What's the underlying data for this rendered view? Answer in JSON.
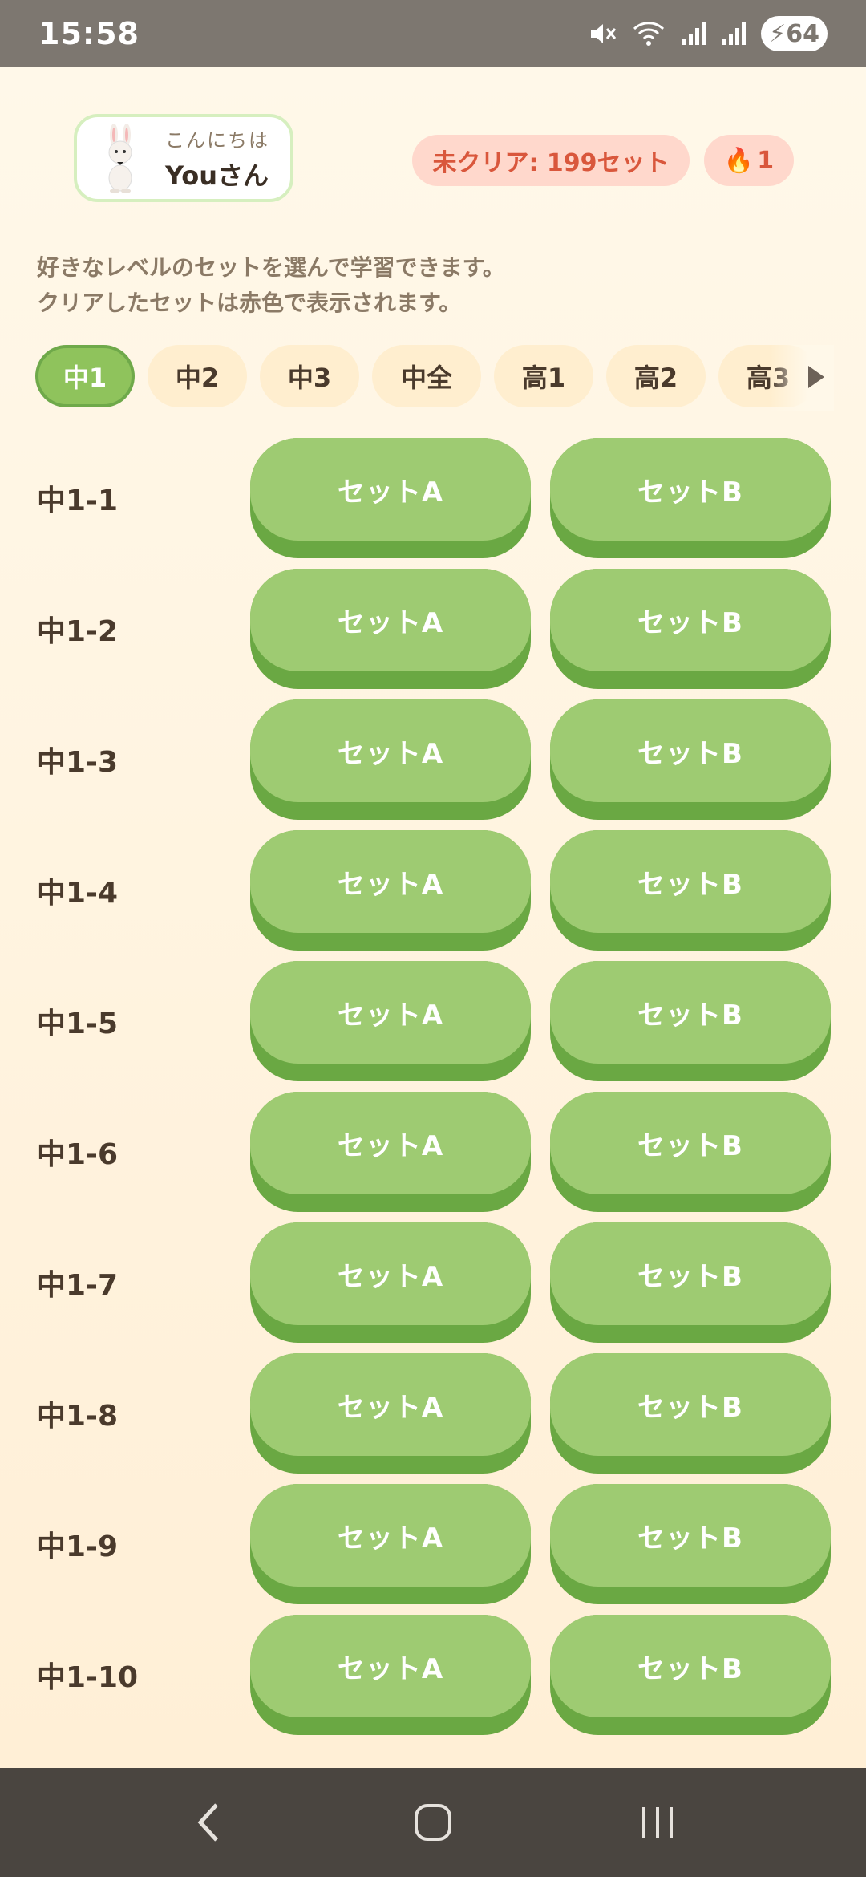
{
  "status": {
    "time": "15:58",
    "battery": "64"
  },
  "greeting": {
    "hello": "こんにちは",
    "name": "Youさん"
  },
  "badges": {
    "uncleared": "未クリア: 199セット",
    "streak": "1",
    "streak_icon": "fire-icon"
  },
  "description": [
    "好きなレベルのセットを選んで学習できます。",
    "クリアしたセットは赤色で表示されます。"
  ],
  "tabs": [
    {
      "label": "中1",
      "active": true
    },
    {
      "label": "中2"
    },
    {
      "label": "中3"
    },
    {
      "label": "中全"
    },
    {
      "label": "高1"
    },
    {
      "label": "高2"
    },
    {
      "label": "高3"
    }
  ],
  "rows": [
    {
      "label": "中1-1",
      "a": "セットA",
      "b": "セットB"
    },
    {
      "label": "中1-2",
      "a": "セットA",
      "b": "セットB"
    },
    {
      "label": "中1-3",
      "a": "セットA",
      "b": "セットB"
    },
    {
      "label": "中1-4",
      "a": "セットA",
      "b": "セットB"
    },
    {
      "label": "中1-5",
      "a": "セットA",
      "b": "セットB"
    },
    {
      "label": "中1-6",
      "a": "セットA",
      "b": "セットB"
    },
    {
      "label": "中1-7",
      "a": "セットA",
      "b": "セットB"
    },
    {
      "label": "中1-8",
      "a": "セットA",
      "b": "セットB"
    },
    {
      "label": "中1-9",
      "a": "セットA",
      "b": "セットB"
    },
    {
      "label": "中1-10",
      "a": "セットA",
      "b": "セットB"
    }
  ],
  "colors": {
    "set_button": "#9ecb72",
    "active_tab": "#8fc35c",
    "badge_bg": "#ffd8cc",
    "badge_text": "#d9573c"
  }
}
